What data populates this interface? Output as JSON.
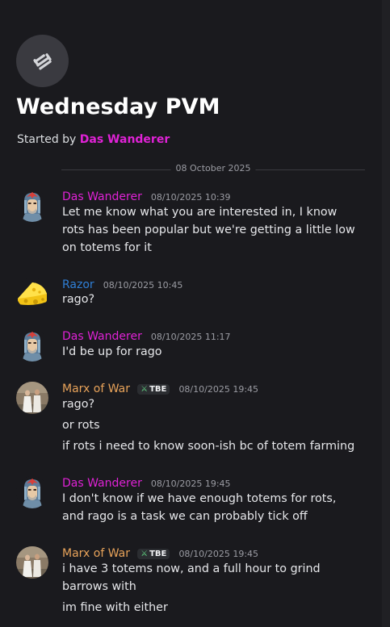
{
  "thread": {
    "icon": "thread-icon",
    "title": "Wednesday PVM",
    "started_by_prefix": "Started by",
    "started_by_author": "Das Wanderer"
  },
  "divider": {
    "date": "08 October 2025"
  },
  "colors": {
    "background": "#1a1a1e",
    "das_wanderer": "#e022d6",
    "razor": "#2f7fd6",
    "marx_of_war": "#e8a35a",
    "timestamp": "#9b9ca3"
  },
  "messages": [
    {
      "author": "Das Wanderer",
      "timestamp": "08/10/2025 10:39",
      "lines": [
        "Let me know what you are interested in, I know rots has been popular but we're getting a little low on totems for it"
      ]
    },
    {
      "author": "Razor",
      "timestamp": "08/10/2025 10:45",
      "lines": [
        "rago?"
      ]
    },
    {
      "author": "Das Wanderer",
      "timestamp": "08/10/2025 11:17",
      "lines": [
        "I'd be up for rago"
      ]
    },
    {
      "author": "Marx of War",
      "tag": "TBE",
      "tag_icon": "sword-icon",
      "timestamp": "08/10/2025 19:45",
      "lines": [
        "rago?",
        "or rots",
        "if rots i need to know soon-ish bc of totem farming"
      ]
    },
    {
      "author": "Das Wanderer",
      "timestamp": "08/10/2025 19:45",
      "lines": [
        "I don't know if we have enough totems for rots, and rago is a task we can probably tick off"
      ]
    },
    {
      "author": "Marx of War",
      "tag": "TBE",
      "tag_icon": "sword-icon",
      "timestamp": "08/10/2025 19:45",
      "lines": [
        "i have 3 totems now, and a full hour to grind barrows with",
        "im fine with either"
      ]
    }
  ]
}
